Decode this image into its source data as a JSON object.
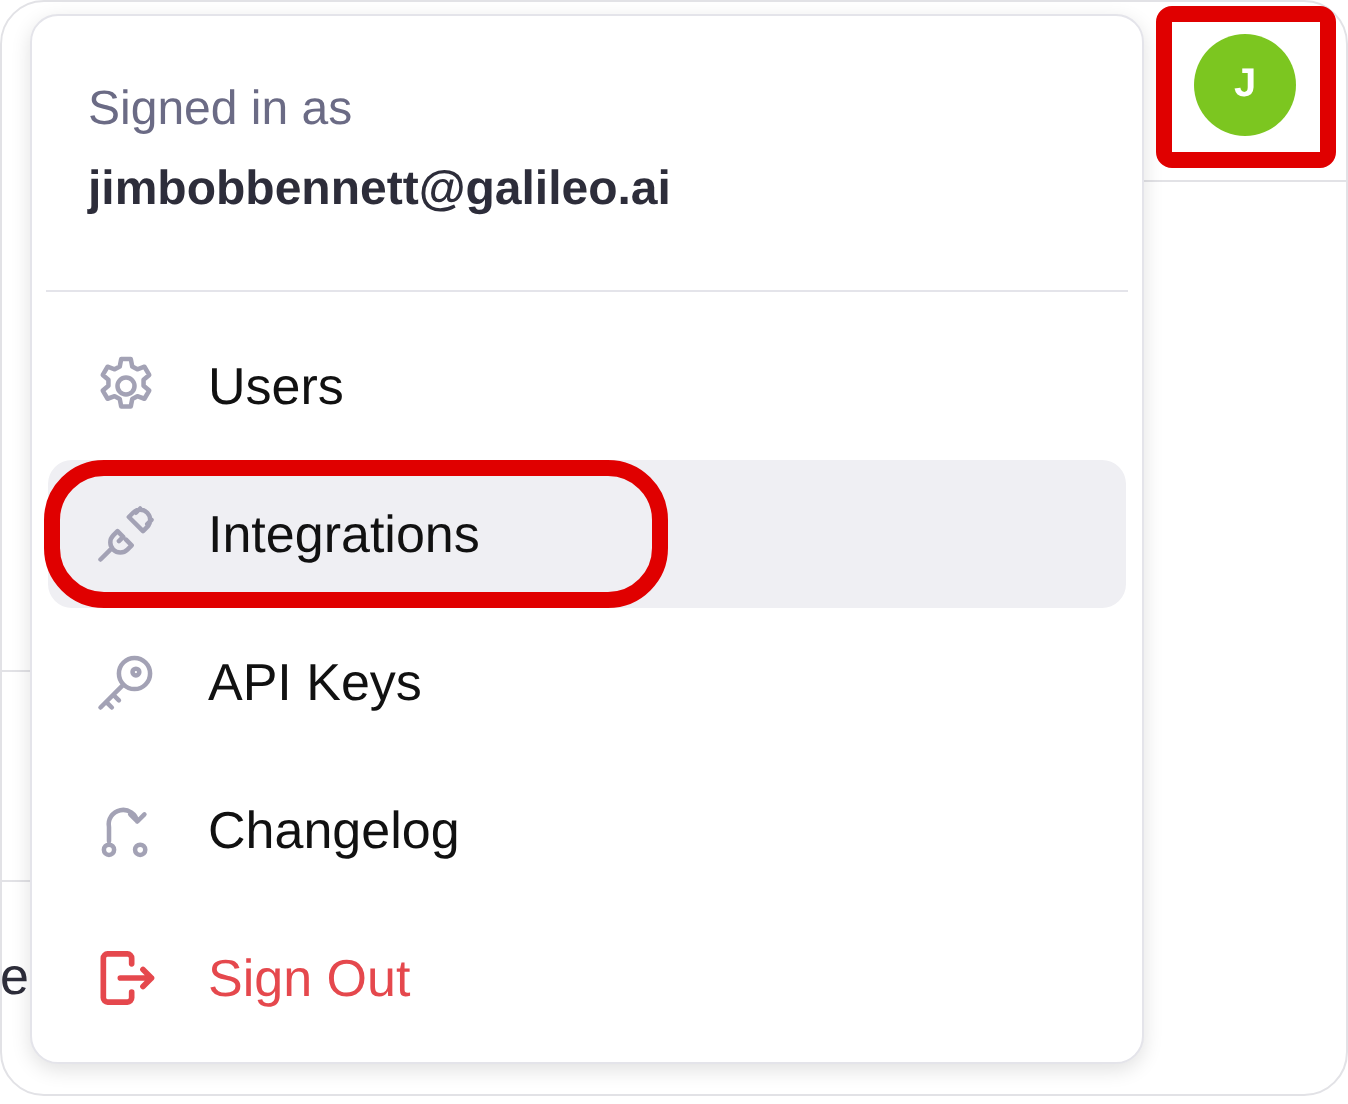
{
  "background_text": "e",
  "avatar": {
    "initial": "J",
    "annotated": true
  },
  "menu": {
    "signed_in_label": "Signed in as",
    "email": "jimbobbennett@galileo.ai",
    "items": [
      {
        "label": "Users",
        "kind": "settings",
        "selected": false
      },
      {
        "label": "Integrations",
        "kind": "plug",
        "selected": true,
        "annotated": true
      },
      {
        "label": "API Keys",
        "kind": "key",
        "selected": false
      },
      {
        "label": "Changelog",
        "kind": "changelog",
        "selected": false
      },
      {
        "label": "Sign Out",
        "kind": "signout",
        "selected": false
      }
    ]
  }
}
